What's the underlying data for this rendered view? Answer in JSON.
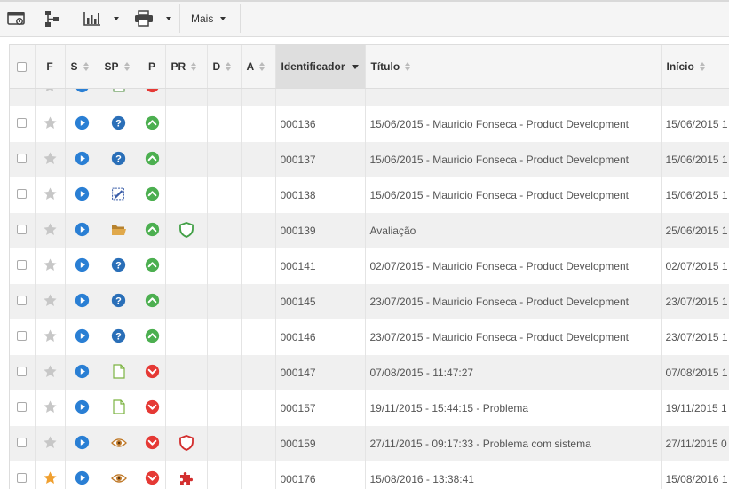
{
  "toolbar": {
    "mais_label": "Mais"
  },
  "columns": {
    "f": "F",
    "s": "S",
    "sp": "SP",
    "p": "P",
    "pr": "PR",
    "d": "D",
    "a": "A",
    "identificador": "Identificador",
    "titulo": "Título",
    "inicio": "Início"
  },
  "colors": {
    "play": "#2a7fd4",
    "help": "#2a6fb8",
    "up_green": "#4caf50",
    "down_red": "#e53935",
    "star_off": "#c7c7c7",
    "star_on": "#f0a030",
    "shield_green": "#43a047",
    "shield_red": "#d32f2f"
  },
  "rows": [
    {
      "id": "000136",
      "title": "15/06/2015 - Mauricio Fonseca - Product Development",
      "inicio": "15/06/2015 1",
      "sp": "help-icon",
      "p": "up",
      "pr": "",
      "starred": false
    },
    {
      "id": "000137",
      "title": "15/06/2015 - Mauricio Fonseca - Product Development",
      "inicio": "15/06/2015 1",
      "sp": "help-icon",
      "p": "up",
      "pr": "",
      "starred": false
    },
    {
      "id": "000138",
      "title": "15/06/2015 - Mauricio Fonseca - Product Development",
      "inicio": "15/06/2015 1",
      "sp": "edit-form-icon",
      "p": "up",
      "pr": "",
      "starred": false
    },
    {
      "id": "000139",
      "title": "Avaliação",
      "inicio": "25/06/2015 1",
      "sp": "folder-open-icon",
      "p": "up",
      "pr": "shield-green-icon",
      "starred": false
    },
    {
      "id": "000141",
      "title": "02/07/2015 - Mauricio Fonseca - Product Development",
      "inicio": "02/07/2015 1",
      "sp": "help-icon",
      "p": "up",
      "pr": "",
      "starred": false
    },
    {
      "id": "000145",
      "title": "23/07/2015 - Mauricio Fonseca - Product Development",
      "inicio": "23/07/2015 1",
      "sp": "help-icon",
      "p": "up",
      "pr": "",
      "starred": false
    },
    {
      "id": "000146",
      "title": "23/07/2015 - Mauricio Fonseca - Product Development",
      "inicio": "23/07/2015 1",
      "sp": "help-icon",
      "p": "up",
      "pr": "",
      "starred": false
    },
    {
      "id": "000147",
      "title": "07/08/2015 - 11:47:27",
      "inicio": "07/08/2015 1",
      "sp": "document-icon",
      "p": "down",
      "pr": "",
      "starred": false
    },
    {
      "id": "000157",
      "title": "19/11/2015 - 15:44:15 - Problema",
      "inicio": "19/11/2015 1",
      "sp": "document-icon",
      "p": "down",
      "pr": "",
      "starred": false
    },
    {
      "id": "000159",
      "title": "27/11/2015 - 09:17:33 - Problema com sistema",
      "inicio": "27/11/2015 0",
      "sp": "eye-icon",
      "p": "down",
      "pr": "shield-red-icon",
      "starred": false
    },
    {
      "id": "000176",
      "title": "15/08/2016 - 13:38:41",
      "inicio": "15/08/2016 1",
      "sp": "eye-icon",
      "p": "down",
      "pr": "puzzle-icon",
      "starred": true
    }
  ]
}
